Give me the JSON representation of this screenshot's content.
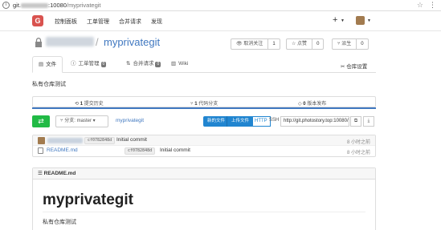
{
  "browser": {
    "url_prefix": "git.",
    "url_port": ":10080",
    "url_path": "/",
    "url_repo": "myprivategit",
    "info_icon": "info-icon",
    "star_icon": "star-icon",
    "menu_icon": "menu-icon"
  },
  "topnav": {
    "links": [
      "控制面板",
      "工单管理",
      "合并请求",
      "发现"
    ],
    "plus": "+",
    "logo_glyph": "G"
  },
  "repo": {
    "sep": "/",
    "name": "myprivategit",
    "description": "私有仓库测试",
    "watch": {
      "label": "取消关注",
      "count": "1"
    },
    "star": {
      "label": "点赞",
      "count": "0"
    },
    "fork": {
      "label": "派生",
      "count": "0"
    }
  },
  "tabs": [
    {
      "label": "文件",
      "badge": ""
    },
    {
      "label": "工单管理",
      "badge": "0"
    },
    {
      "label": "合并请求",
      "badge": "0"
    },
    {
      "label": "Wiki",
      "badge": ""
    }
  ],
  "settings_label": "仓库设置",
  "stats": [
    {
      "count": "1",
      "label": "提交历史"
    },
    {
      "count": "1",
      "label": "代码分支"
    },
    {
      "count": "0",
      "label": "版本发布"
    }
  ],
  "toolbar": {
    "branch_prefix": "分支:",
    "branch": "master",
    "repo_link": "myprivategit",
    "new_file": "新的文件",
    "upload_file": "上传文件",
    "http": "HTTP",
    "ssh": "SSH",
    "clone_url": "http://git.photostory.top:10080/"
  },
  "latest_commit": {
    "sha": "cf0782848d",
    "message": "Initial commit",
    "time": "8 小时之前"
  },
  "files": [
    {
      "name": "README.md",
      "sha": "cf0782848d",
      "message": "Initial commit",
      "time": "8 小时之前"
    }
  ],
  "readme": {
    "header": "README.md",
    "title": "myprivategit",
    "body": "私有仓库测试"
  },
  "colors": {
    "link": "#4078c0",
    "green": "#21ba45",
    "blue": "#2185d0",
    "logo": "#d9534f"
  }
}
